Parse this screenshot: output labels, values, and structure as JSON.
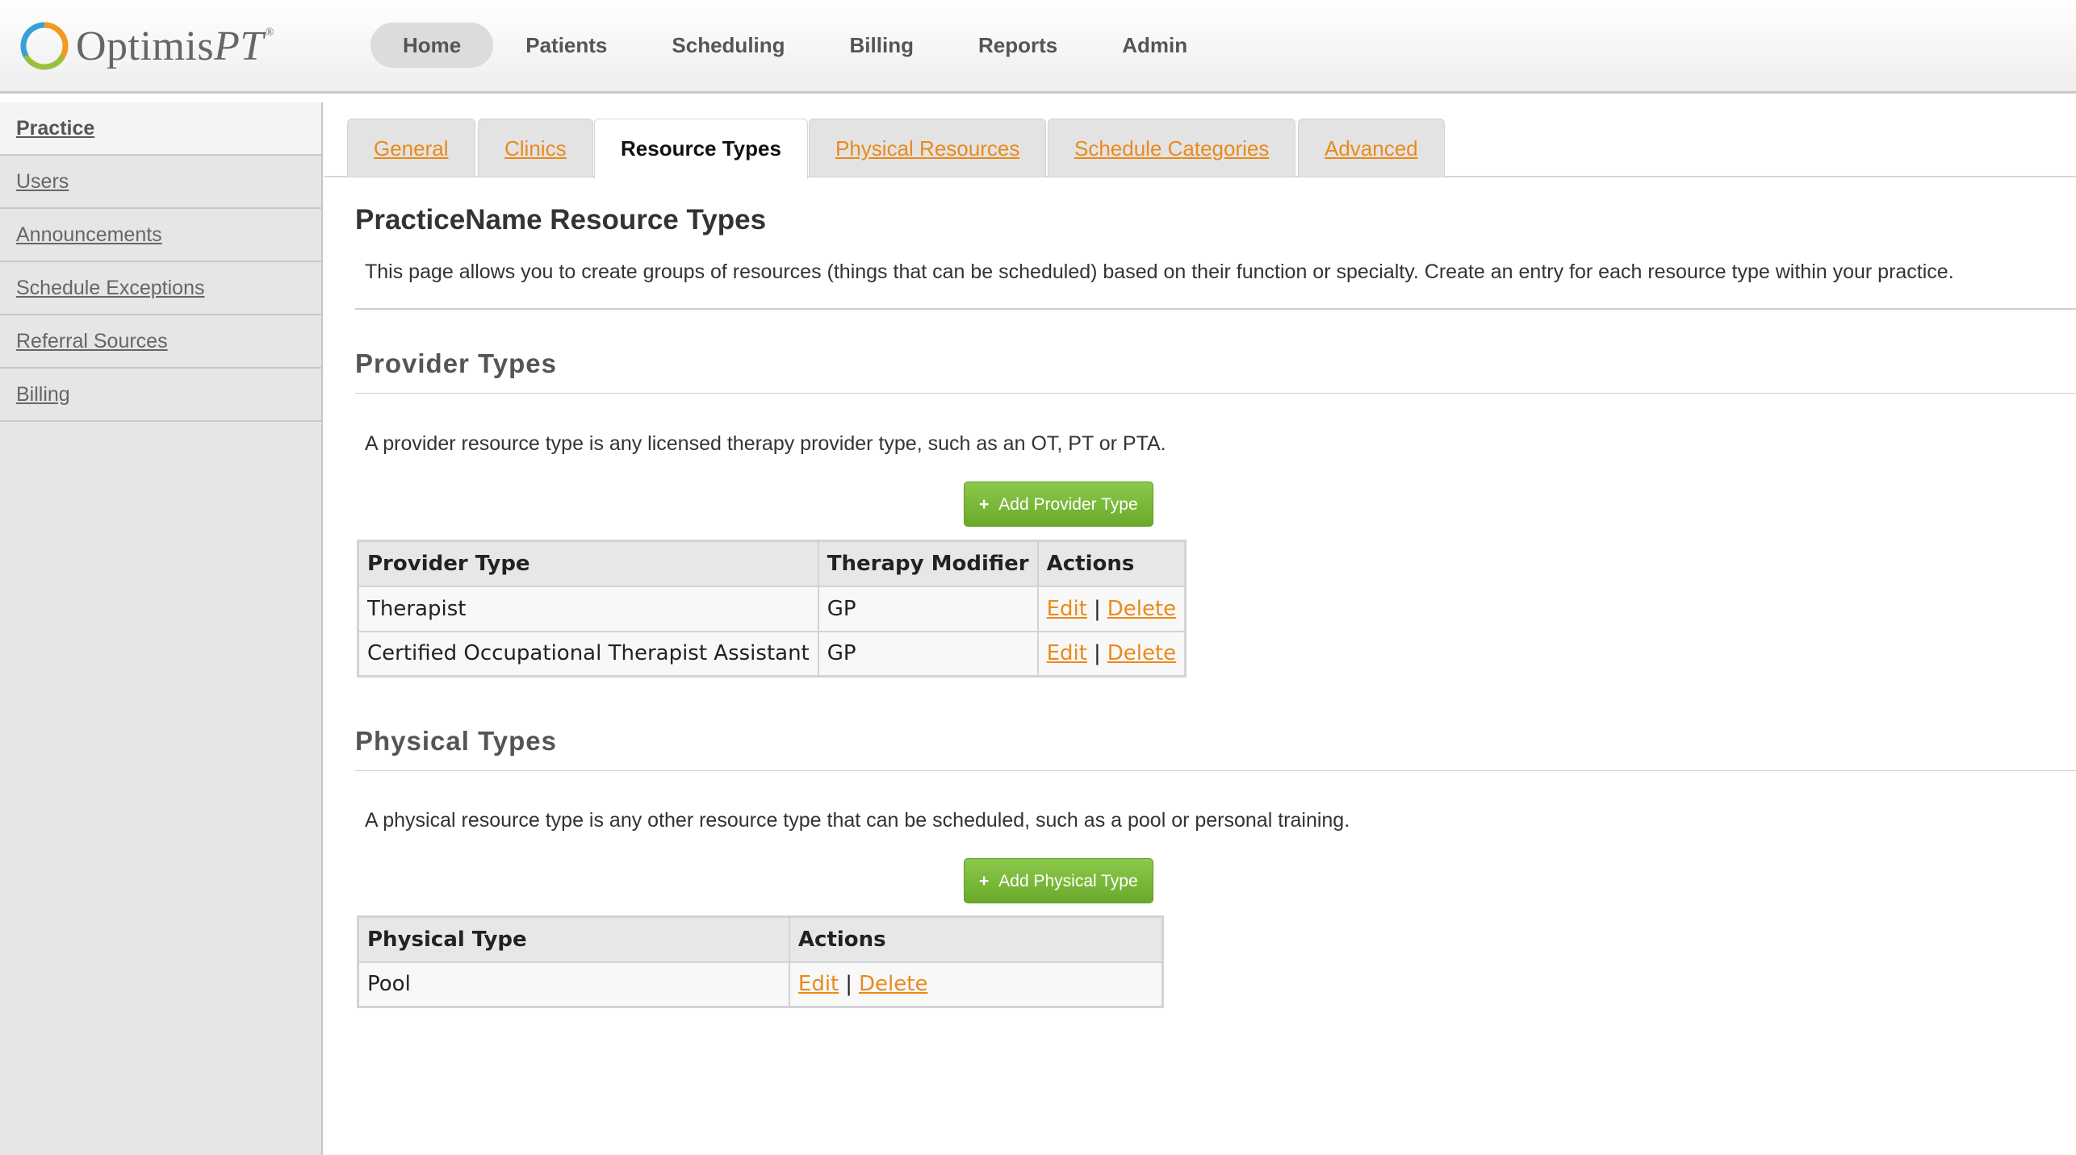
{
  "brand": {
    "logo_main": "Optimis",
    "logo_pt": "PT",
    "logo_mark": "®",
    "accent": "#e98a1b",
    "button_green": "#7ab83b"
  },
  "nav": [
    "Home",
    "Patients",
    "Scheduling",
    "Billing",
    "Reports",
    "Admin"
  ],
  "nav_active": "Home",
  "sidebar": {
    "active": "Practice",
    "items": [
      "Practice",
      "Users",
      "Announcements",
      "Schedule Exceptions",
      "Referral Sources",
      "Billing"
    ]
  },
  "tabs": {
    "active": "Resource Types",
    "items": [
      "General",
      "Clinics",
      "Resource Types",
      "Physical Resources",
      "Schedule Categories",
      "Advanced"
    ]
  },
  "page": {
    "title": "PracticeName Resource Types",
    "description": "This page allows you to create groups of resources (things that can be scheduled) based on their function or specialty. Create an entry for each resource type within your practice."
  },
  "provider": {
    "title": "Provider Types",
    "description": "A provider resource type is any licensed therapy provider type, such as an OT, PT or PTA.",
    "button_icon": "+",
    "button_label": "Add Provider Type",
    "headers": [
      "Provider Type",
      "Therapy Modifier",
      "Actions"
    ],
    "rows": [
      {
        "type": "Therapist",
        "modifier": "GP"
      },
      {
        "type": "Certified Occupational Therapist Assistant",
        "modifier": "GP"
      }
    ]
  },
  "physical": {
    "title": "Physical Types",
    "description": "A physical resource type is any other resource type that can be scheduled, such as a pool or personal training.",
    "button_icon": "+",
    "button_label": "Add Physical Type",
    "headers": [
      "Physical Type",
      "Actions"
    ],
    "rows": [
      {
        "type": "Pool"
      }
    ]
  },
  "actions": {
    "edit": "Edit",
    "sep": "|",
    "delete": "Delete"
  }
}
